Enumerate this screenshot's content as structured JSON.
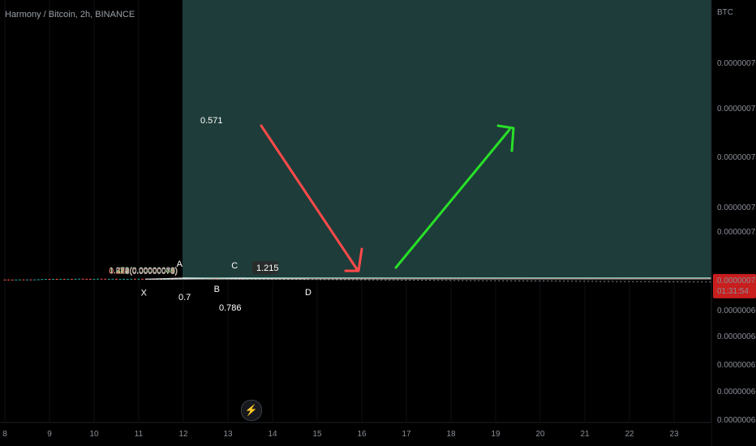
{
  "header": {
    "symbol_title": "Harmony / Bitcoin, 2h, BINANCE"
  },
  "price_axis": {
    "currency": "BTC"
  },
  "current_price": {
    "label": "0.00000071",
    "countdown": "01:31:54"
  },
  "colors": {
    "up": "#26a69a",
    "down": "#ef5350",
    "red_arrow": "#ff4a4a",
    "green_arrow": "#28e028",
    "pattern_fill": "#c9c9c9"
  },
  "icons": {
    "lightning": "lightning-icon"
  },
  "chart_data": {
    "type": "candlestick",
    "title": "Harmony / Bitcoin, 2h, BINANCE",
    "y_unit": "BTC",
    "ylim": [
      6.5e-07,
      8e-07
    ],
    "x_tick_labels": [
      "8",
      "9",
      "10",
      "11",
      "12",
      "13",
      "14",
      "15",
      "16",
      "17",
      "18",
      "19",
      "20",
      "21",
      "22",
      "23"
    ],
    "y_tick_labels": [
      "0.00000079",
      "0.00000077",
      "0.00000075",
      "0.00000073",
      "0.00000072",
      "0.00000070",
      "0.00000069",
      "0.00000068",
      "0.00000067",
      "0.00000066",
      "0.00000065"
    ],
    "fib_levels": [
      {
        "label": "1.272(0.00000080)",
        "ratio": 1.272,
        "price": 8e-07
      },
      {
        "label": "1(0.00000078)",
        "ratio": 1,
        "price": 7.8e-07
      },
      {
        "label": "0.786(0.00000076)",
        "ratio": 0.786,
        "price": 7.6e-07
      },
      {
        "label": "0.618(0.00000075)",
        "ratio": 0.618,
        "price": 7.5e-07
      },
      {
        "label": "0.5(0.00000074)",
        "ratio": 0.5,
        "price": 7.4e-07
      },
      {
        "label": "0.382(0.00000073)",
        "ratio": 0.382,
        "price": 7.3e-07
      },
      {
        "label": "0.236(0.00000072)",
        "ratio": 0.236,
        "price": 7.2e-07
      },
      {
        "label": "0(0.00000070)",
        "ratio": 0,
        "price": 7e-07
      }
    ],
    "harmonic_points": [
      {
        "label": "X",
        "day": 11.15,
        "price": 6.8e-07
      },
      {
        "label": "A",
        "day": 11.95,
        "price": 7.8e-07
      },
      {
        "label": "B",
        "day": 12.75,
        "price": 7.05e-07
      },
      {
        "label": "C",
        "day": 13.15,
        "price": 7.52e-07
      },
      {
        "label": "D",
        "day": 14.8,
        "price": 7e-07
      }
    ],
    "pattern_ratios": [
      "0.571",
      "0.7",
      "0.786",
      "1.215"
    ],
    "annotations": {
      "projection_down": "red arrow",
      "projection_up": "green arrow"
    },
    "current_price": 7.1e-07
  }
}
